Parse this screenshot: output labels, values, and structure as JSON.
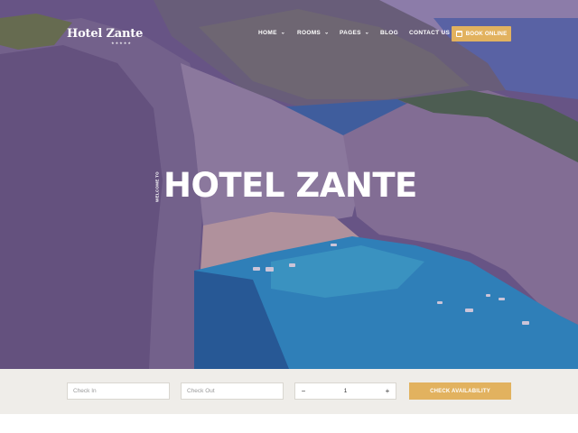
{
  "header": {
    "logo_text": "Hotel Zante",
    "logo_stars": "★★★★★",
    "nav": [
      {
        "label": "HOME",
        "has_dropdown": true
      },
      {
        "label": "ROOMS",
        "has_dropdown": true
      },
      {
        "label": "PAGES",
        "has_dropdown": true
      },
      {
        "label": "BLOG",
        "has_dropdown": false
      },
      {
        "label": "CONTACT US",
        "has_dropdown": false
      }
    ],
    "chevron": "⌄",
    "book_button": {
      "label": "BOOK ONLINE",
      "icon": "calendar-icon"
    }
  },
  "hero": {
    "welcome_text": "WELCOME TO",
    "title": "HOTEL ZANTE"
  },
  "booking": {
    "check_in_placeholder": "Check In",
    "check_out_placeholder": "Check Out",
    "guests_minus": "−",
    "guests_value": "1",
    "guests_plus": "+",
    "check_button": "CHECK AVAILABILITY"
  },
  "colors": {
    "accent": "#e2b25f",
    "booking_bar": "#efede9"
  }
}
